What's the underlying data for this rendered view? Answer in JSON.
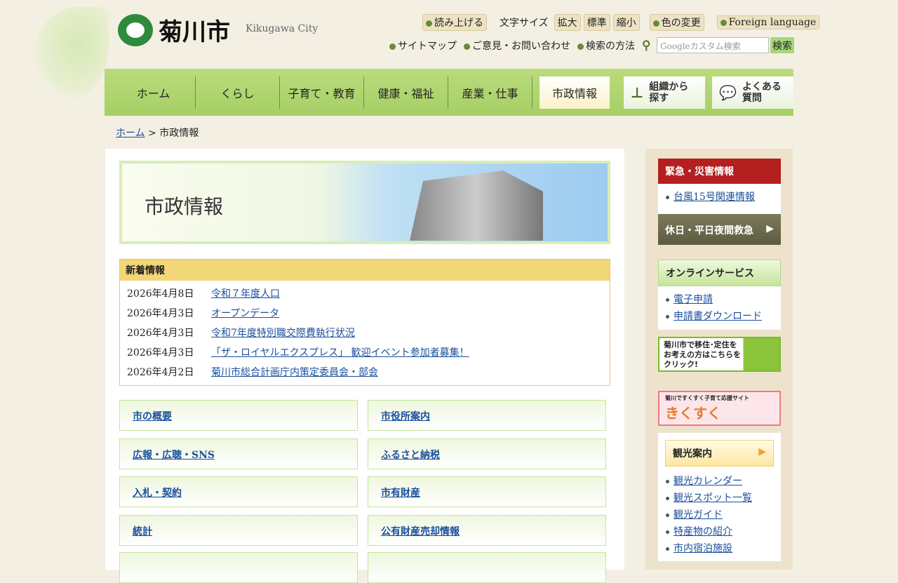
{
  "header": {
    "logo_text": "菊川市",
    "logo_en": "Kikugawa City",
    "read_aloud": "読み上げる",
    "font_size_label": "文字サイズ",
    "font_large": "拡大",
    "font_normal": "標準",
    "font_small": "縮小",
    "color_change": "色の変更",
    "foreign": "Foreign language",
    "sitemap": "サイトマップ",
    "contact": "ご意見・お問い合わせ",
    "search_howto": "検索の方法",
    "search_placeholder": "Googleカスタム検索",
    "search_button": "検索"
  },
  "nav": {
    "items": [
      "ホーム",
      "くらし",
      "子育て・教育",
      "健康・福祉",
      "産業・仕事",
      "市政情報"
    ],
    "org": "組織から探す",
    "faq": "よくある質問"
  },
  "breadcrumb": {
    "home": "ホーム",
    "sep": ">",
    "current": "市政情報"
  },
  "banner_title": "市政情報",
  "news": {
    "title": "新着情報",
    "items": [
      {
        "date": "2026年4月8日",
        "title": "令和７年度人口"
      },
      {
        "date": "2026年4月3日",
        "title": "オープンデータ"
      },
      {
        "date": "2026年4月3日",
        "title": "令和7年度特別職交際費執行状況"
      },
      {
        "date": "2026年4月3日",
        "title": "「ザ・ロイヤルエクスプレス」 歓迎イベント参加者募集！"
      },
      {
        "date": "2026年4月2日",
        "title": "菊川市総合計画庁内策定委員会・部会"
      }
    ]
  },
  "categories": [
    "市の概要",
    "市役所案内",
    "広報・広聴・SNS",
    "ふるさと納税",
    "入札・契約",
    "市有財産",
    "統計",
    "公有財産売却情報"
  ],
  "sidebar": {
    "emergency_title": "緊急・災害情報",
    "emergency_items": [
      "台風15号関連情報"
    ],
    "holiday": "休日・平日夜間救急",
    "online_title": "オンラインサービス",
    "online_items": [
      "電子申請",
      "申請書ダウンロード"
    ],
    "migration_banner": "菊川市で移住･定住をお考えの方はこちらをクリック!",
    "kids_banner_sub": "菊川ですくすく子育て応援サイト",
    "kids_banner": "きくすく",
    "tourism_title": "観光案内",
    "tourism_items": [
      "観光カレンダー",
      "観光スポット一覧",
      "観光ガイド",
      "特産物の紹介",
      "市内宿泊施設"
    ]
  }
}
